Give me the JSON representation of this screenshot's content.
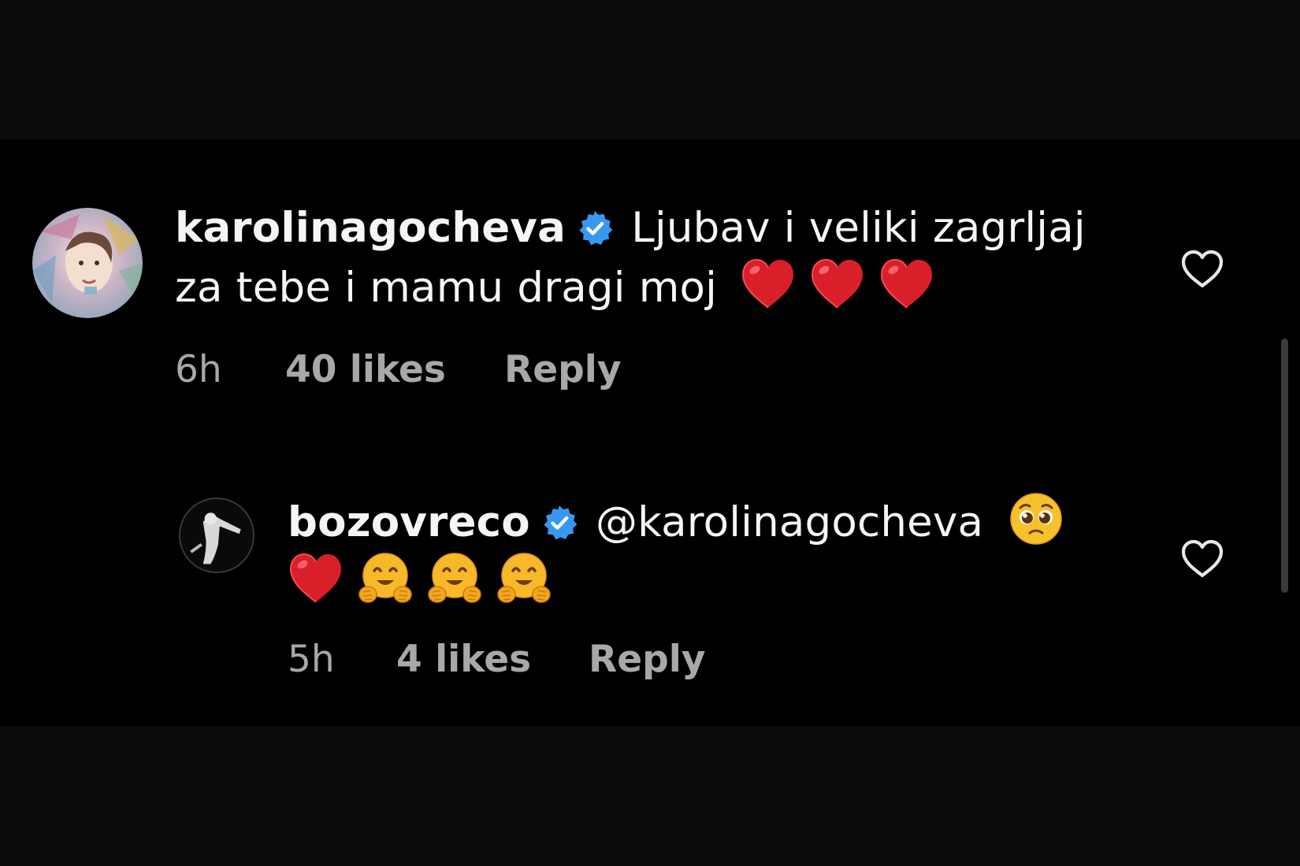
{
  "comments": [
    {
      "username": "karolinagocheva",
      "verified": true,
      "text_line1": "Ljubav i veliki zagrljaj",
      "text_line2": "za tebe i mamu dragi moj",
      "emojis": [
        "red-heart",
        "red-heart",
        "red-heart"
      ],
      "time": "6h",
      "likes": "40 likes",
      "reply": "Reply"
    },
    {
      "username": "bozovreco",
      "verified": true,
      "mention": "@karolinagocheva",
      "emojis_line1": [
        "pleading-face"
      ],
      "emojis_line2": [
        "red-heart",
        "hugging-face",
        "hugging-face",
        "hugging-face"
      ],
      "time": "5h",
      "likes": "4 likes",
      "reply": "Reply"
    }
  ],
  "colors": {
    "background": "#000000",
    "outer": "#0c0b0b",
    "text": "#f5f5f5",
    "meta": "#a8a8a8",
    "verified_badge": "#3897f0",
    "heart_emoji": "#e0262d"
  },
  "icons": {
    "like": "heart-outline-icon",
    "verified": "verified-badge-icon"
  }
}
